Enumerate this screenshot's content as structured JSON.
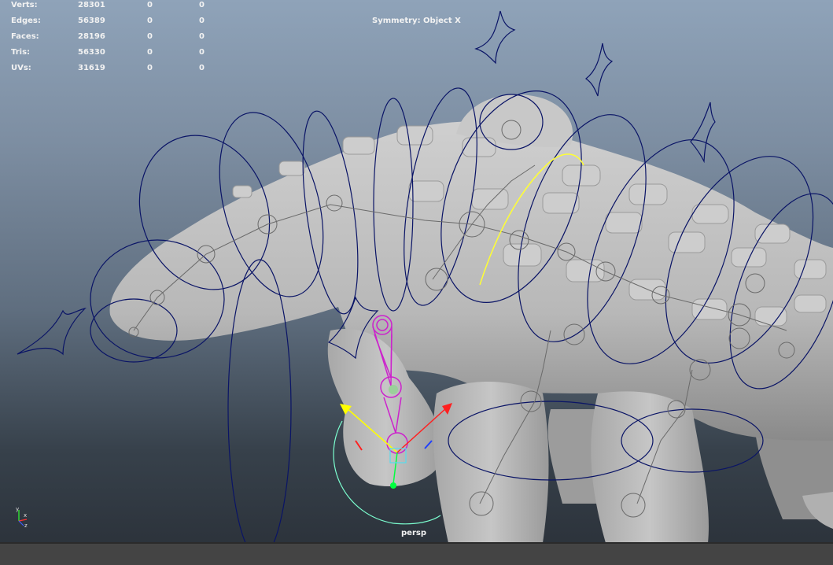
{
  "hud": {
    "rows": [
      {
        "label": "Verts:",
        "value": "28301",
        "c1": "0",
        "c2": "0"
      },
      {
        "label": "Edges:",
        "value": "56389",
        "c1": "0",
        "c2": "0"
      },
      {
        "label": "Faces:",
        "value": "28196",
        "c1": "0",
        "c2": "0"
      },
      {
        "label": "Tris:",
        "value": "56330",
        "c1": "0",
        "c2": "0"
      },
      {
        "label": "UVs:",
        "value": "31619",
        "c1": "0",
        "c2": "0"
      }
    ],
    "symmetry": "Symmetry: Object X",
    "camera": "persp"
  },
  "axes": {
    "x": "x",
    "y": "y",
    "z": "z"
  },
  "colors": {
    "mesh": "#bfbfbf",
    "control_curve": "#0a1466",
    "selected_joint": "#cc22cc",
    "manip_x": "#ff2020",
    "manip_y": "#ffff00",
    "manip_z": "#00ff40",
    "rotate_ring": "#7cffd0",
    "active_curve": "#ffff33"
  }
}
